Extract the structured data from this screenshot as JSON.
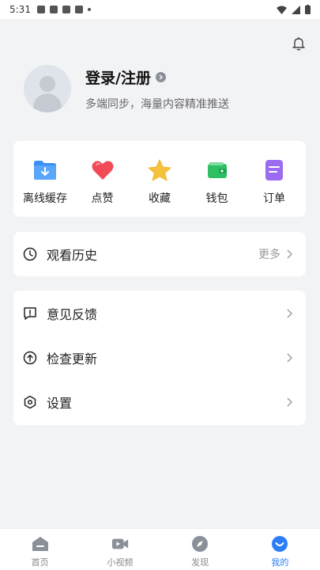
{
  "status_bar": {
    "time": "5:31"
  },
  "profile": {
    "title": "登录/注册",
    "subtitle": "多端同步，海量内容精准推送"
  },
  "shortcuts": [
    {
      "label": "离线缓存",
      "icon": "download-folder-icon",
      "color": "#3a8ef6"
    },
    {
      "label": "点赞",
      "icon": "heart-icon",
      "color": "#f24b57"
    },
    {
      "label": "收藏",
      "icon": "star-icon",
      "color": "#f5c33b"
    },
    {
      "label": "钱包",
      "icon": "wallet-icon",
      "color": "#2fbf62"
    },
    {
      "label": "订单",
      "icon": "order-icon",
      "color": "#9b6cf2"
    }
  ],
  "history": {
    "label": "观看历史",
    "more": "更多"
  },
  "settings": {
    "items": [
      {
        "label": "意见反馈",
        "icon": "feedback-icon"
      },
      {
        "label": "检查更新",
        "icon": "update-icon"
      },
      {
        "label": "设置",
        "icon": "settings-icon"
      }
    ]
  },
  "nav": {
    "items": [
      {
        "label": "首页",
        "icon": "home-icon"
      },
      {
        "label": "小视频",
        "icon": "video-icon"
      },
      {
        "label": "发现",
        "icon": "discover-icon"
      },
      {
        "label": "我的",
        "icon": "me-icon",
        "active": true
      }
    ],
    "active_color": "#2c7ef8"
  }
}
